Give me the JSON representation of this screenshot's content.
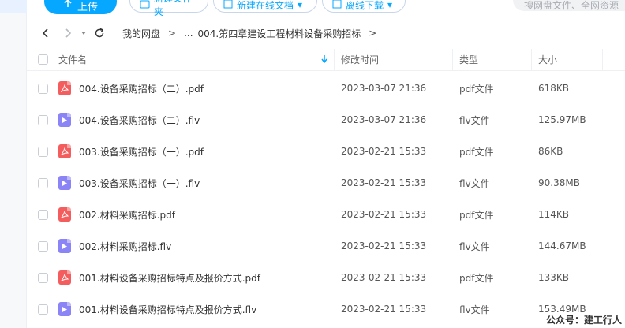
{
  "toolbar": {
    "upload_label": "上传",
    "new_folder_label": "新建文件夹",
    "new_online_doc_label": "新建在线文档",
    "offline_download_label": "离线下载",
    "search_placeholder": "搜网盘文件、全网资源"
  },
  "breadcrumb": {
    "root": "我的网盘",
    "ellipsis": "...",
    "current": "004.第四章建设工程材料设备采购招标",
    "separator": ">"
  },
  "table": {
    "headers": {
      "name": "文件名",
      "modified": "修改时间",
      "type": "类型",
      "size": "大小"
    },
    "rows": [
      {
        "icon": "pdf-file-icon",
        "name": "004.设备采购招标（二）.pdf",
        "modified": "2023-03-07 21:36",
        "type": "pdf文件",
        "size": "618KB"
      },
      {
        "icon": "video-file-icon",
        "name": "004.设备采购招标（二）.flv",
        "modified": "2023-03-07 21:36",
        "type": "flv文件",
        "size": "125.97MB"
      },
      {
        "icon": "pdf-file-icon",
        "name": "003.设备采购招标（一）.pdf",
        "modified": "2023-02-21 15:33",
        "type": "pdf文件",
        "size": "86KB"
      },
      {
        "icon": "video-file-icon",
        "name": "003.设备采购招标（一）.flv",
        "modified": "2023-02-21 15:33",
        "type": "flv文件",
        "size": "90.38MB"
      },
      {
        "icon": "pdf-file-icon",
        "name": "002.材料采购招标.pdf",
        "modified": "2023-02-21 15:33",
        "type": "pdf文件",
        "size": "114KB"
      },
      {
        "icon": "video-file-icon",
        "name": "002.材料采购招标.flv",
        "modified": "2023-02-21 15:33",
        "type": "flv文件",
        "size": "144.67MB"
      },
      {
        "icon": "pdf-file-icon",
        "name": "001.材料设备采购招标特点及报价方式.pdf",
        "modified": "2023-02-21 15:33",
        "type": "pdf文件",
        "size": "133KB"
      },
      {
        "icon": "video-file-icon",
        "name": "001.材料设备采购招标特点及报价方式.flv",
        "modified": "2023-02-21 15:33",
        "type": "flv文件",
        "size": "153.49MB"
      }
    ]
  },
  "watermark": "公众号：建工行人",
  "colors": {
    "accent": "#06a7ff",
    "pdf": "#f45d5d",
    "flv": "#8b84f6"
  }
}
